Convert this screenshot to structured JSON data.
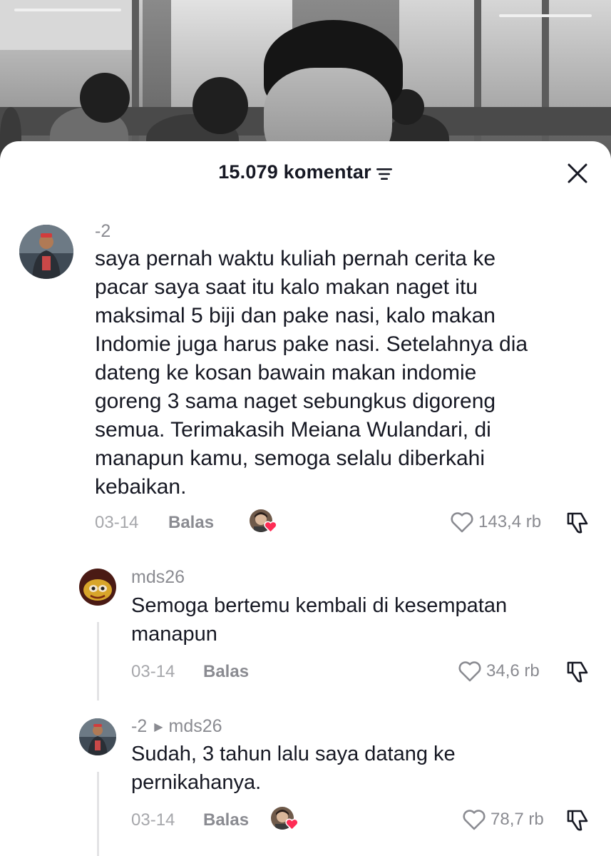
{
  "header": {
    "comment_count": "15.079 komentar"
  },
  "icons": {
    "filter": "filter-icon",
    "close": "close-icon",
    "like": "heart-outline-icon",
    "dislike": "thumbs-down-icon",
    "liked_by_creator_heart": "heart-filled-icon"
  },
  "colors": {
    "heart_accent": "#fe2c55",
    "muted_text": "#8a8b91"
  },
  "comments": [
    {
      "username": "-2",
      "text": "saya pernah waktu kuliah pernah cerita ke pacar saya saat itu kalo makan naget itu maksimal 5 biji dan pake nasi, kalo makan Indomie juga harus pake nasi. Setelahnya dia dateng ke kosan bawain makan indomie goreng 3 sama naget sebungkus digoreng semua. Terimakasih Meiana Wulandari, di manapun kamu, semoga selalu diberkahi kebaikan.",
      "lines": [
        "saya pernah waktu kuliah pernah cerita ke",
        "pacar saya saat itu kalo makan naget itu",
        "maksimal 5 biji dan pake nasi, kalo makan",
        "Indomie juga harus pake nasi. Setelahnya dia",
        "dateng ke kosan bawain makan indomie",
        "goreng 3 sama naget sebungkus digoreng",
        "semua. Terimakasih Meiana Wulandari, di",
        "manapun kamu, semoga selalu diberkahi",
        "kebaikan."
      ],
      "date": "03-14",
      "reply_label": "Balas",
      "likes": "143,4 rb",
      "liked_by_creator": true
    }
  ],
  "replies": [
    {
      "username": "mds26",
      "lines": [
        "Semoga bertemu kembali di kesempatan",
        "manapun"
      ],
      "date": "03-14",
      "reply_label": "Balas",
      "likes": "34,6 rb",
      "liked_by_creator": false
    },
    {
      "username": "-2",
      "reply_to": "mds26",
      "lines": [
        "Sudah, 3 tahun lalu saya datang ke",
        "pernikahanya."
      ],
      "date": "03-14",
      "reply_label": "Balas",
      "likes": "78,7 rb",
      "liked_by_creator": true
    }
  ]
}
